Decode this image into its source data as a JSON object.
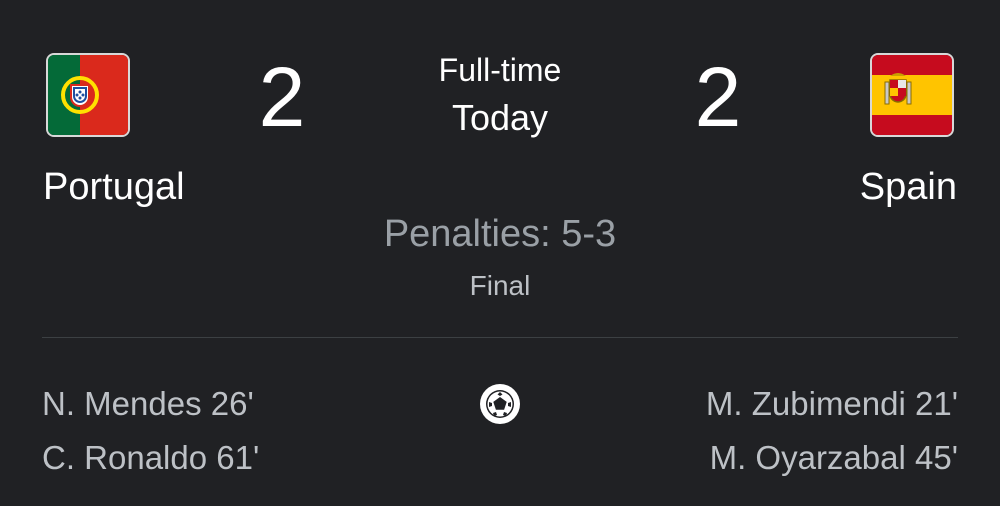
{
  "match": {
    "status": "Full-time",
    "date": "Today",
    "penalties": "Penalties: 5-3",
    "stage": "Final"
  },
  "home": {
    "name": "Portugal",
    "score": "2",
    "flag_icon": "portugal-flag-icon",
    "flag_colors": {
      "green": "#046a38",
      "red": "#da291c",
      "yellow": "#ffe100"
    },
    "scorers": [
      {
        "text": "N. Mendes 26'"
      },
      {
        "text": "C. Ronaldo 61'"
      }
    ]
  },
  "away": {
    "name": "Spain",
    "score": "2",
    "flag_icon": "spain-flag-icon",
    "flag_colors": {
      "red": "#c60b1e",
      "yellow": "#ffc400"
    },
    "scorers": [
      {
        "text": "M. Zubimendi 21'"
      },
      {
        "text": "M. Oyarzabal 45'"
      }
    ]
  },
  "goal_icon": "soccer-ball-icon",
  "colors": {
    "background": "#202124",
    "primary_text": "#ffffff",
    "secondary_text": "#bdc1c6",
    "muted_text": "#9aa0a6",
    "divider": "#3c4043"
  }
}
